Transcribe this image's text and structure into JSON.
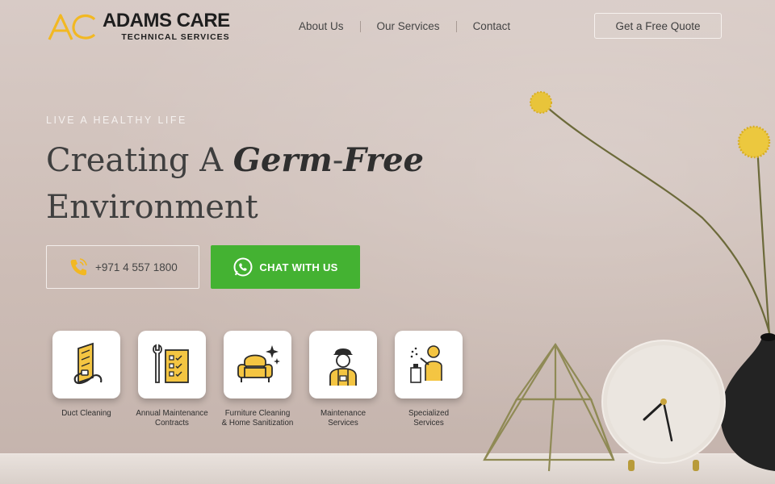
{
  "brand": {
    "name": "ADAMS CARE",
    "subtitle": "TECHNICAL SERVICES",
    "mark": "AC",
    "accent": "#f2b822"
  },
  "nav": {
    "items": [
      {
        "label": "About Us"
      },
      {
        "label": "Our Services"
      },
      {
        "label": "Contact"
      }
    ]
  },
  "header": {
    "quote_label": "Get a Free Quote"
  },
  "hero": {
    "kicker": "LIVE A HEALTHY LIFE",
    "headline_prefix": "Creating A ",
    "headline_em1": "Germ",
    "headline_dash": "-",
    "headline_em2": "Free",
    "headline_line2": "Environment",
    "phone": "+971 4 557 1800",
    "chat_label": "CHAT WITH US",
    "chat_color": "#44b232"
  },
  "services": [
    {
      "line1": "Duct Cleaning",
      "line2": "",
      "icon": "duct-cleaning-icon"
    },
    {
      "line1": "Annual Maintenance",
      "line2": "Contracts",
      "icon": "maintenance-checklist-icon"
    },
    {
      "line1": "Furniture Cleaning",
      "line2": "& Home Sanitization",
      "icon": "armchair-sparkle-icon"
    },
    {
      "line1": "Maintenance",
      "line2": "Services",
      "icon": "technician-icon"
    },
    {
      "line1": "Specialized",
      "line2": "Services",
      "icon": "sanitizer-spray-icon"
    }
  ]
}
